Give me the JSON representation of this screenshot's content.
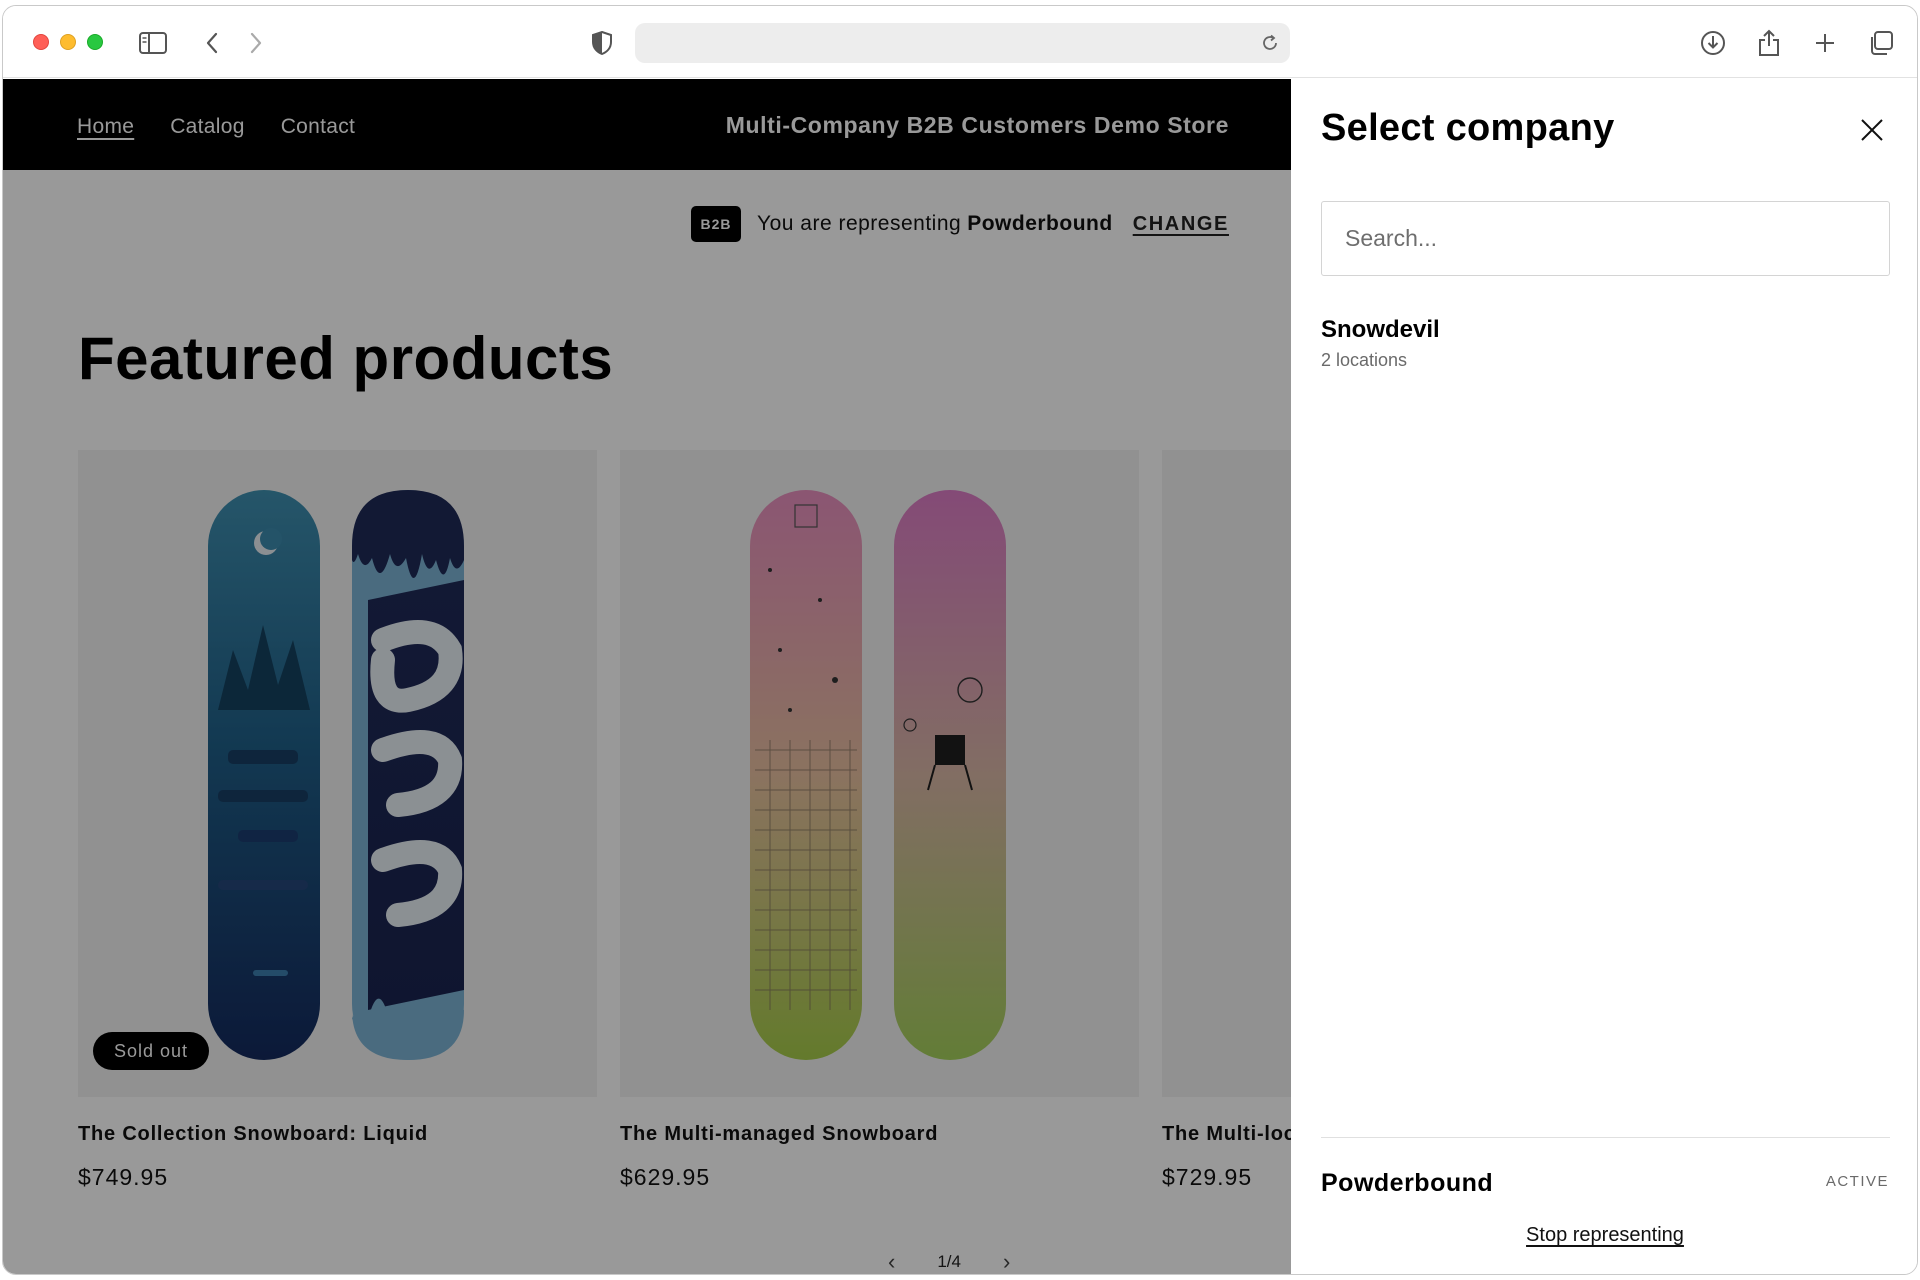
{
  "browser": {
    "icons": [
      "sidebar-icon",
      "back-icon",
      "forward-icon",
      "shield-icon",
      "reload-icon",
      "download-icon",
      "share-icon",
      "new-tab-icon",
      "tabs-overview-icon"
    ]
  },
  "store": {
    "nav": [
      "Home",
      "Catalog",
      "Contact"
    ],
    "title": "Multi-Company B2B Customers Demo Store",
    "b2b_badge": "B2B",
    "b2b_text": "You are representing",
    "b2b_company": "Powderbound",
    "b2b_change": "CHANGE",
    "featured_heading": "Featured products",
    "products": [
      {
        "name": "The Collection Snowboard: Liquid",
        "price": "$749.95",
        "badge": "Sold out"
      },
      {
        "name": "The Multi-managed Snowboard",
        "price": "$629.95"
      },
      {
        "name": "The Multi-loc",
        "price": "$729.95"
      }
    ],
    "pager": {
      "current": "1/4",
      "prev": "‹",
      "next": "›"
    }
  },
  "drawer": {
    "title": "Select company",
    "search_placeholder": "Search...",
    "companies": [
      {
        "name": "Snowdevil",
        "sub": "2 locations"
      }
    ],
    "active_company": "Powderbound",
    "active_label": "ACTIVE",
    "stop_label": "Stop representing"
  },
  "colors": {
    "header_bg": "#000000",
    "overlay": "rgba(0,0,0,0.4)",
    "drawer_bg": "#ffffff"
  }
}
